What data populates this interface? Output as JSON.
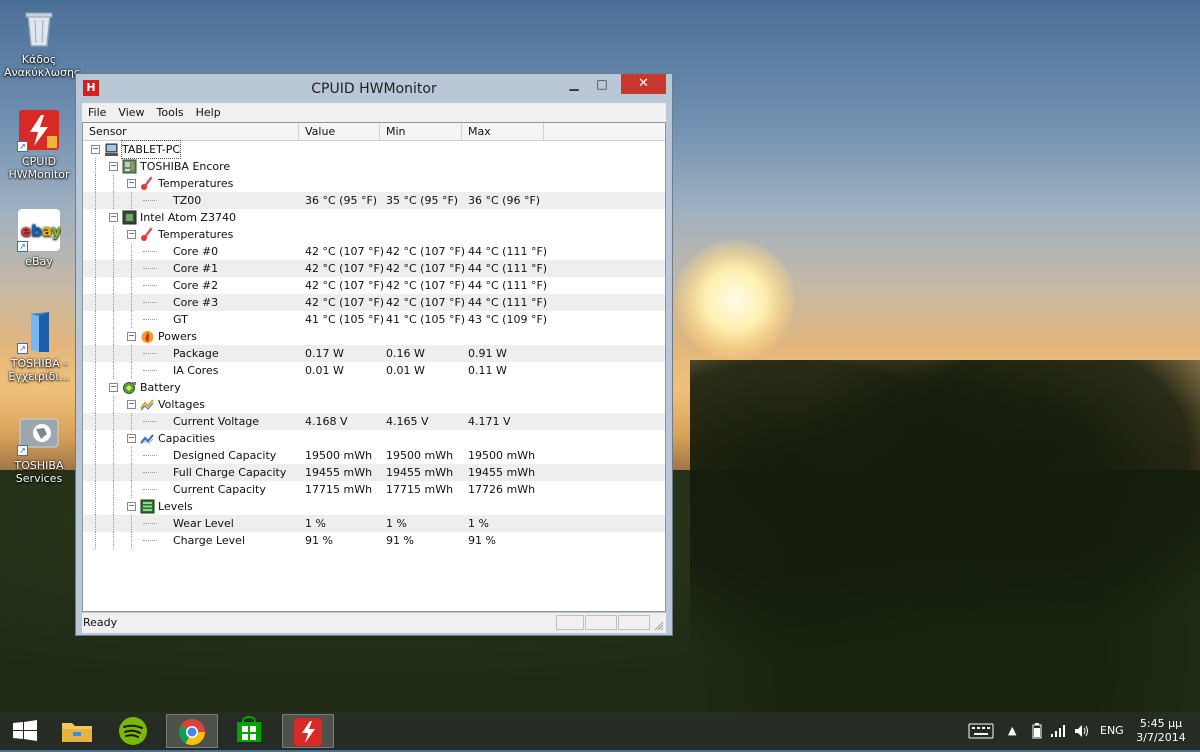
{
  "desktop": {
    "icons": [
      {
        "label": "Κάδος Ανακύκλωσης",
        "icon": "recycle-bin-icon"
      },
      {
        "label": "CPUID HWMonitor",
        "icon": "hwmonitor-icon"
      },
      {
        "label": "eBay",
        "icon": "ebay-icon"
      },
      {
        "label": "TOSHIBA - Εγχειρίδι...",
        "icon": "toshiba-manual-icon"
      },
      {
        "label": "TOSHIBA Services",
        "icon": "toshiba-services-icon"
      }
    ]
  },
  "window": {
    "title": "CPUID HWMonitor",
    "app_icon_letter": "H",
    "minimize": "▁",
    "maximize": "□",
    "close": "✕",
    "menu": [
      "File",
      "View",
      "Tools",
      "Help"
    ],
    "columns": [
      "Sensor",
      "Value",
      "Min",
      "Max"
    ],
    "status": "Ready"
  },
  "tree": [
    {
      "level": 0,
      "label": "TABLET-PC",
      "expander": "−",
      "icon": "computer-icon"
    },
    {
      "level": 1,
      "label": "TOSHIBA Encore",
      "expander": "−",
      "icon": "motherboard-icon"
    },
    {
      "level": 2,
      "label": "Temperatures",
      "expander": "−",
      "icon": "thermometer-icon"
    },
    {
      "level": 3,
      "label": "TZ00",
      "value": "36 °C  (95 °F)",
      "min": "35 °C  (95 °F)",
      "max": "36 °C  (96 °F)"
    },
    {
      "level": 1,
      "label": "Intel Atom Z3740",
      "expander": "−",
      "icon": "cpu-chip-icon"
    },
    {
      "level": 2,
      "label": "Temperatures",
      "expander": "−",
      "icon": "thermometer-icon"
    },
    {
      "level": 3,
      "label": "Core #0",
      "value": "42 °C  (107 °F)",
      "min": "42 °C  (107 °F)",
      "max": "44 °C  (111 °F)"
    },
    {
      "level": 3,
      "label": "Core #1",
      "value": "42 °C  (107 °F)",
      "min": "42 °C  (107 °F)",
      "max": "44 °C  (111 °F)"
    },
    {
      "level": 3,
      "label": "Core #2",
      "value": "42 °C  (107 °F)",
      "min": "42 °C  (107 °F)",
      "max": "44 °C  (111 °F)"
    },
    {
      "level": 3,
      "label": "Core #3",
      "value": "42 °C  (107 °F)",
      "min": "42 °C  (107 °F)",
      "max": "44 °C  (111 °F)"
    },
    {
      "level": 3,
      "label": "GT",
      "value": "41 °C  (105 °F)",
      "min": "41 °C  (105 °F)",
      "max": "43 °C  (109 °F)"
    },
    {
      "level": 2,
      "label": "Powers",
      "expander": "−",
      "icon": "flame-icon"
    },
    {
      "level": 3,
      "label": "Package",
      "value": "0.17 W",
      "min": "0.16 W",
      "max": "0.91 W"
    },
    {
      "level": 3,
      "label": "IA Cores",
      "value": "0.01 W",
      "min": "0.01 W",
      "max": "0.11 W"
    },
    {
      "level": 1,
      "label": "Battery",
      "expander": "−",
      "icon": "battery-icon"
    },
    {
      "level": 2,
      "label": "Voltages",
      "expander": "−",
      "icon": "voltage-icon"
    },
    {
      "level": 3,
      "label": "Current Voltage",
      "value": "4.168 V",
      "min": "4.165 V",
      "max": "4.171 V"
    },
    {
      "level": 2,
      "label": "Capacities",
      "expander": "−",
      "icon": "capacity-icon"
    },
    {
      "level": 3,
      "label": "Designed Capacity",
      "value": "19500 mWh",
      "min": "19500 mWh",
      "max": "19500 mWh"
    },
    {
      "level": 3,
      "label": "Full Charge Capacity",
      "value": "19455 mWh",
      "min": "19455 mWh",
      "max": "19455 mWh"
    },
    {
      "level": 3,
      "label": "Current Capacity",
      "value": "17715 mWh",
      "min": "17715 mWh",
      "max": "17726 mWh"
    },
    {
      "level": 2,
      "label": "Levels",
      "expander": "−",
      "icon": "levels-icon"
    },
    {
      "level": 3,
      "label": "Wear Level",
      "value": "1 %",
      "min": "1 %",
      "max": "1 %"
    },
    {
      "level": 3,
      "label": "Charge Level",
      "value": "91 %",
      "min": "91 %",
      "max": "91 %"
    }
  ],
  "taskbar": {
    "items": [
      "start-icon",
      "file-explorer-icon",
      "spotify-icon",
      "chrome-icon",
      "store-icon",
      "hwmonitor-icon"
    ],
    "active_index": 5,
    "tray": {
      "language": "ENG",
      "time": "5:45 μμ",
      "date": "3/7/2014"
    }
  },
  "colors": {
    "close_button": "#c7392e",
    "app_red": "#d31f1f",
    "window_frame": "#b9c7d6",
    "alt_row": "#eeeeee"
  }
}
